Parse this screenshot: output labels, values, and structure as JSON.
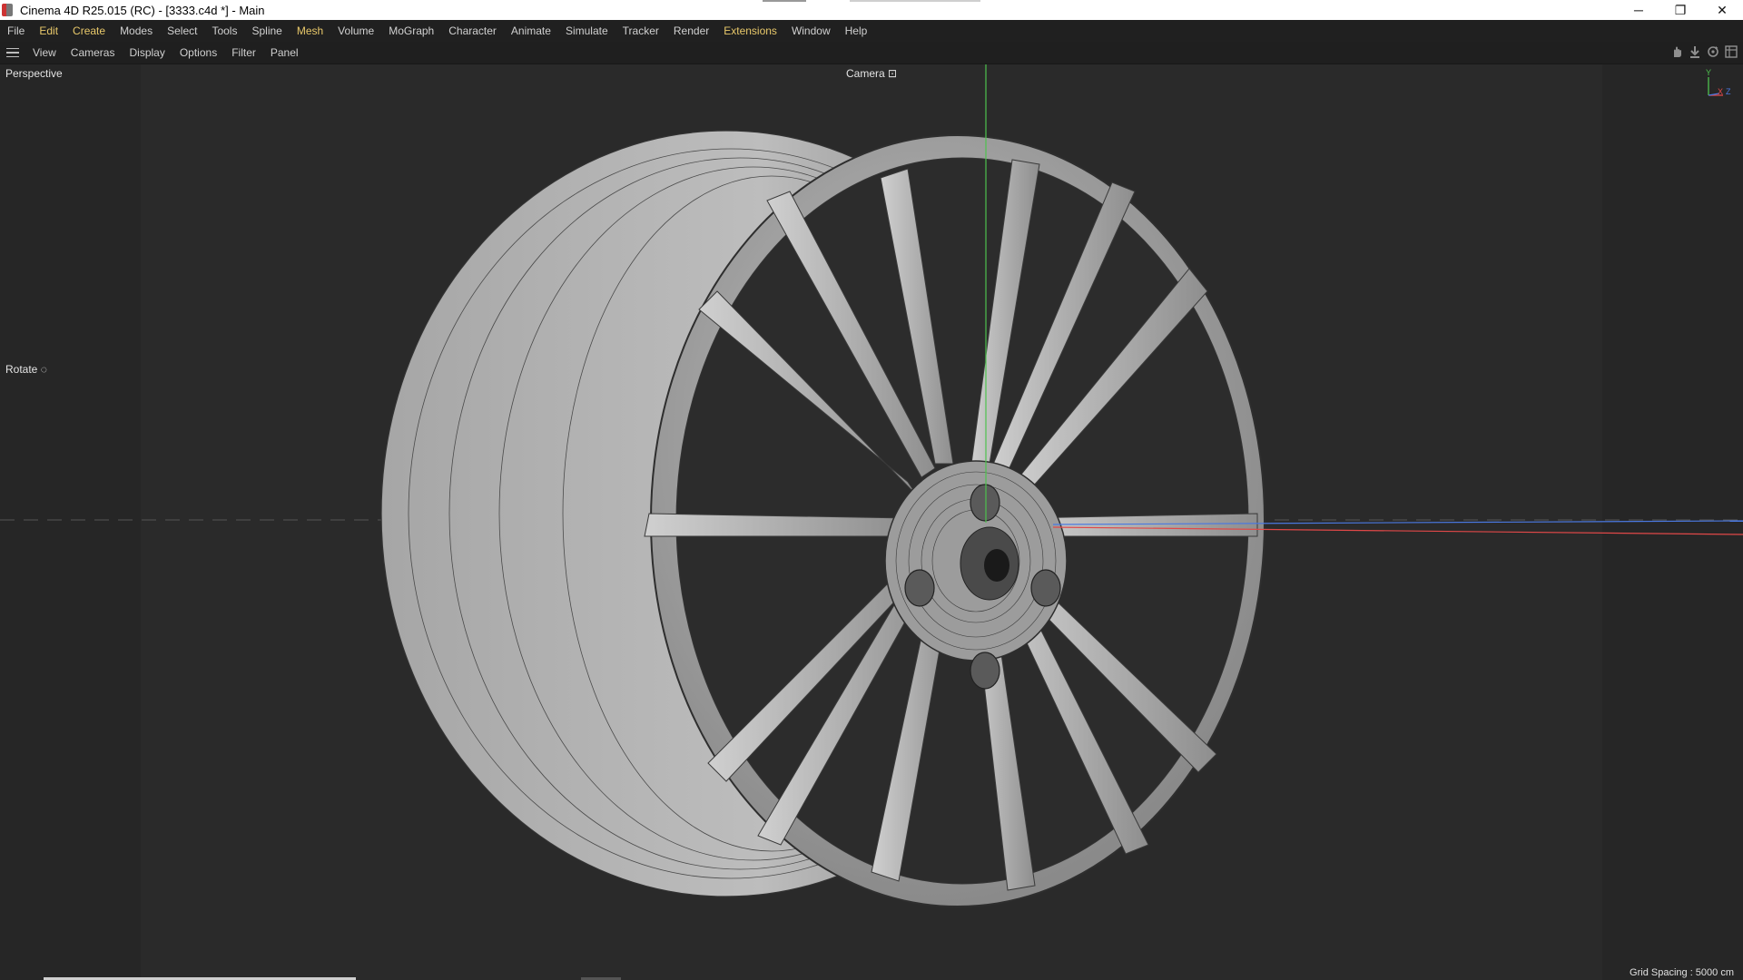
{
  "window": {
    "title": "Cinema 4D R25.015 (RC) - [3333.c4d *] - Main",
    "controls": {
      "minimize": "─",
      "restore": "❐",
      "close": "✕"
    }
  },
  "menubar": {
    "items": [
      {
        "label": "File"
      },
      {
        "label": "Edit"
      },
      {
        "label": "Create"
      },
      {
        "label": "Modes"
      },
      {
        "label": "Select"
      },
      {
        "label": "Tools"
      },
      {
        "label": "Spline"
      },
      {
        "label": "Mesh"
      },
      {
        "label": "Volume"
      },
      {
        "label": "MoGraph"
      },
      {
        "label": "Character"
      },
      {
        "label": "Animate"
      },
      {
        "label": "Simulate"
      },
      {
        "label": "Tracker"
      },
      {
        "label": "Render"
      },
      {
        "label": "Extensions"
      },
      {
        "label": "Window"
      },
      {
        "label": "Help"
      }
    ]
  },
  "viewport_menu": {
    "items": [
      {
        "label": "View"
      },
      {
        "label": "Cameras"
      },
      {
        "label": "Display"
      },
      {
        "label": "Options"
      },
      {
        "label": "Filter"
      },
      {
        "label": "Panel"
      }
    ],
    "nav_icons": [
      "pan-icon",
      "zoom-icon",
      "rotate-icon",
      "maximize-panel-icon"
    ]
  },
  "viewport": {
    "view_name": "Perspective",
    "camera_label": "Camera",
    "camera_icon": "⊡",
    "tool_label": "Rotate",
    "tool_icon": "◌",
    "grid_spacing": "Grid Spacing : 5000 cm",
    "axis": {
      "y": "Y",
      "x": "X",
      "z": "Z"
    }
  },
  "colors": {
    "menu_highlight": "#e8c86a",
    "axis_y": "#4ec24e",
    "axis_x": "#e04848",
    "axis_z": "#4a78e0"
  }
}
